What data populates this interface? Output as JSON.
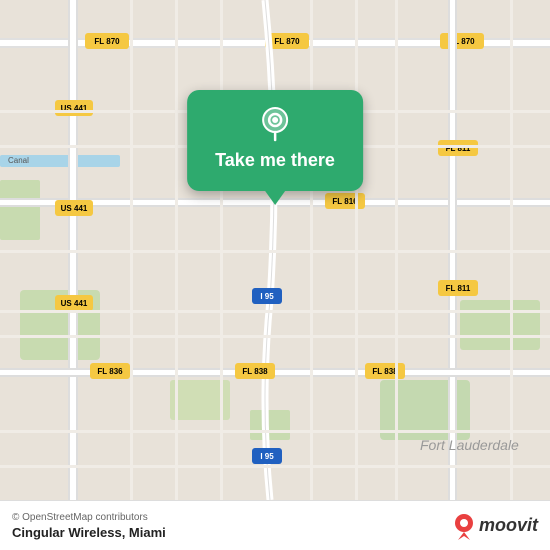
{
  "map": {
    "attribution": "© OpenStreetMap contributors",
    "background_color": "#e4ddd4",
    "road_color": "#ffffff",
    "highway_color": "#f5c842"
  },
  "popup": {
    "button_label": "Take me there",
    "background_color": "#2eaa6e",
    "pin_color": "#ffffff"
  },
  "bottom_bar": {
    "place_name": "Cingular Wireless, Miami",
    "attribution": "© OpenStreetMap contributors",
    "logo_text": "moovit"
  },
  "roads": {
    "labels": [
      "US 441",
      "FL 870",
      "FL 816",
      "FL 811",
      "FL 838",
      "I 95",
      "FL 836"
    ]
  }
}
